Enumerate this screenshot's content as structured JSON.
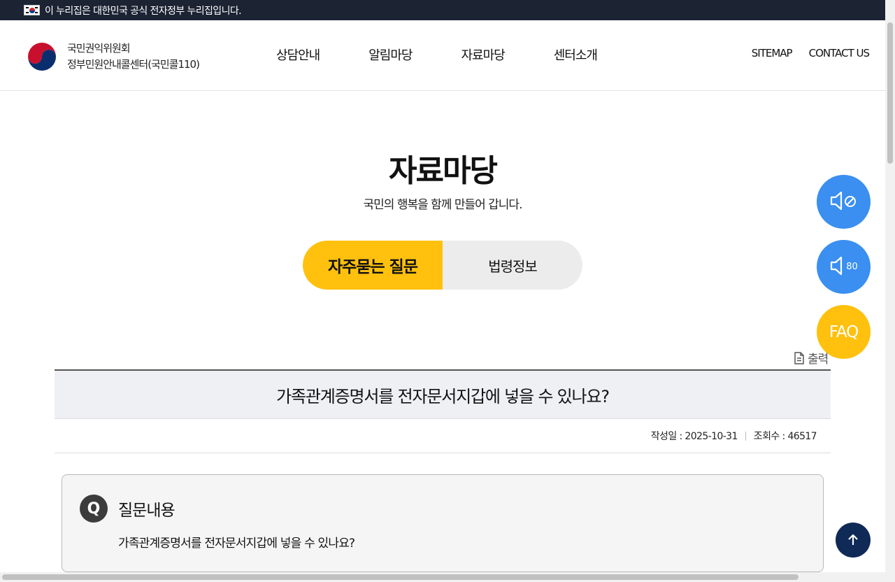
{
  "banner": {
    "text": "이 누리집은 대한민국 공식 전자정부 누리집입니다."
  },
  "header": {
    "logo_line1": "국민권익위원회",
    "logo_line2": "정부민원안내콜센터(국민콜110)",
    "nav": [
      "상담안내",
      "알림마당",
      "자료마당",
      "센터소개"
    ],
    "util": [
      "SITEMAP",
      "CONTACT US"
    ]
  },
  "hero": {
    "title": "자료마당",
    "subtitle": "국민의 행복을 함께 만들어 갑니다."
  },
  "tabs": [
    {
      "label": "자주묻는 질문",
      "active": true
    },
    {
      "label": "법령정보",
      "active": false
    }
  ],
  "float": {
    "mute_icon": "speaker-mute-icon",
    "volume_icon": "speaker-volume-icon",
    "volume_value": "80",
    "faq_label": "FAQ"
  },
  "print_label": "출력",
  "article": {
    "title": "가족관계증명서를 전자문서지갑에 넣을 수 있나요?",
    "date_label": "작성일 : 2025-10-31",
    "views_label": "조회수 : 46517"
  },
  "question": {
    "badge": "Q",
    "heading": "질문내용",
    "body": "가족관계증명서를 전자문서지갑에 넣을 수 있나요?"
  },
  "colors": {
    "banner_bg": "#1c2333",
    "accent_yellow": "#ffc10e",
    "float_blue": "#3a8ff0",
    "top_button": "#0f2a56"
  }
}
